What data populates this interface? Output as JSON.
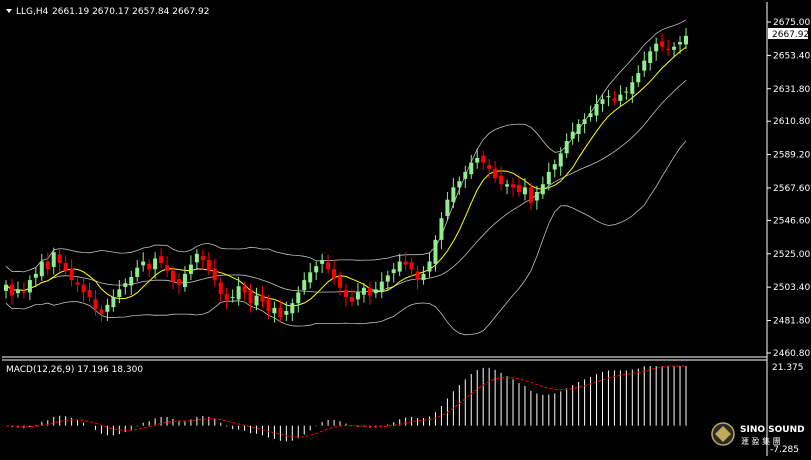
{
  "window": {
    "symbol_timeframe": "LLG,H4",
    "ohlc": "2661.19 2670.17 2657.84 2667.92"
  },
  "price_axis": {
    "ticks": [
      "2675.00",
      "2653.40",
      "2631.80",
      "2610.80",
      "2589.20",
      "2567.60",
      "2546.60",
      "2525.00",
      "2503.40",
      "2481.80",
      "2460.80"
    ],
    "current_price_label": "2667.92"
  },
  "macd": {
    "label": "MACD(12,26,9) 17.196 18.300",
    "axis_top": "21.375",
    "axis_bottom": "-7.285"
  },
  "watermark": {
    "brand": "SINO SOUND",
    "subtitle": "滙 盈 集 團"
  },
  "colors": {
    "background": "#000000",
    "bull_candle": "#90ee90",
    "bear_candle": "#ff0000",
    "bollinger": "#c0c0c0",
    "ma": "#ffff00",
    "macd_hist": "#ffffff",
    "macd_signal": "#ff0000",
    "separator": "#ffffff"
  },
  "chart_data": {
    "type": "candlestick",
    "price_range": [
      2460.8,
      2675.0
    ],
    "macd_range": [
      -7.285,
      21.375
    ],
    "close": [
      2505,
      2498,
      2502,
      2500,
      2508,
      2512,
      2520,
      2515,
      2526,
      2519,
      2514,
      2508,
      2505,
      2500,
      2497,
      2489,
      2486,
      2492,
      2497,
      2502,
      2506,
      2510,
      2516,
      2520,
      2515,
      2522,
      2519,
      2514,
      2507,
      2505,
      2512,
      2518,
      2525,
      2521,
      2514,
      2508,
      2499,
      2495,
      2497,
      2504,
      2500,
      2493,
      2498,
      2494,
      2488,
      2490,
      2484,
      2488,
      2493,
      2500,
      2508,
      2513,
      2517,
      2521,
      2515,
      2509,
      2503,
      2497,
      2494,
      2500,
      2503,
      2498,
      2502,
      2507,
      2511,
      2515,
      2520,
      2518,
      2515,
      2508,
      2512,
      2520,
      2534,
      2548,
      2560,
      2568,
      2572,
      2578,
      2584,
      2587,
      2584,
      2580,
      2574,
      2570,
      2570,
      2568,
      2565,
      2568,
      2558,
      2565,
      2570,
      2578,
      2583,
      2590,
      2598,
      2604,
      2609,
      2612,
      2616,
      2622,
      2625,
      2627,
      2624,
      2628,
      2630,
      2636,
      2642,
      2650,
      2656,
      2661,
      2659,
      2657,
      2659,
      2662,
      2666
    ]
  }
}
